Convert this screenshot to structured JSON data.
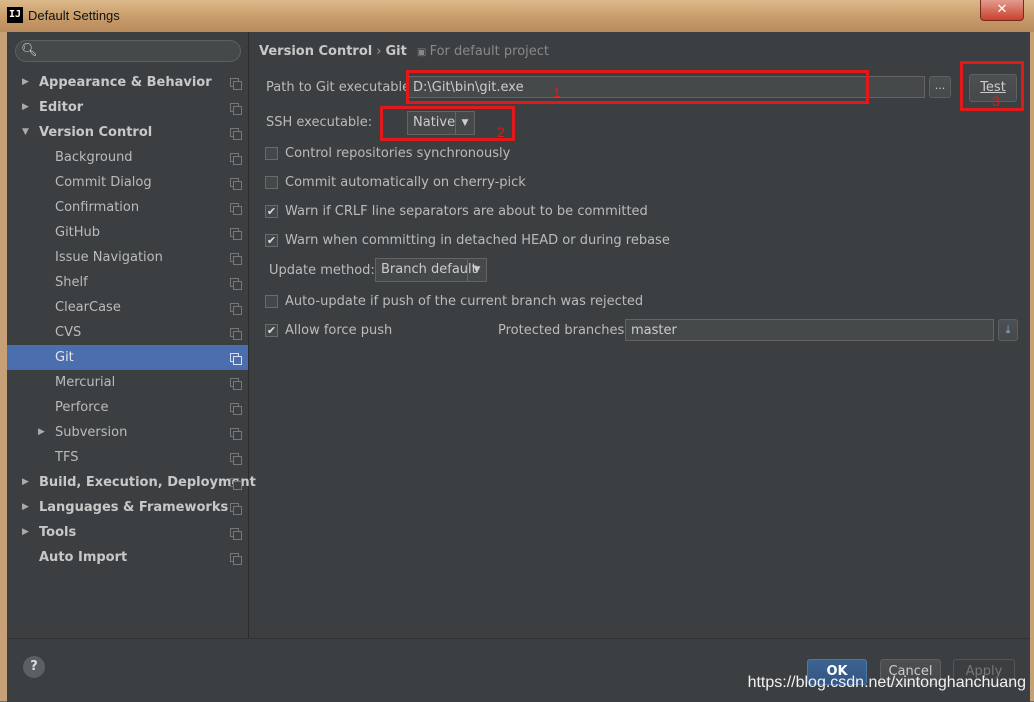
{
  "window": {
    "title": "Default Settings",
    "close_glyph": "✕",
    "app_icon_text": "IJ"
  },
  "sidebar": {
    "search_placeholder": "",
    "items": [
      {
        "label": "Appearance & Behavior",
        "bold": true,
        "arrow": "▶"
      },
      {
        "label": "Editor",
        "bold": true,
        "arrow": "▶"
      },
      {
        "label": "Version Control",
        "bold": true,
        "arrow": "▼"
      },
      {
        "label": "Background"
      },
      {
        "label": "Commit Dialog"
      },
      {
        "label": "Confirmation"
      },
      {
        "label": "GitHub"
      },
      {
        "label": "Issue Navigation"
      },
      {
        "label": "Shelf"
      },
      {
        "label": "ClearCase"
      },
      {
        "label": "CVS"
      },
      {
        "label": "Git",
        "selected": true
      },
      {
        "label": "Mercurial"
      },
      {
        "label": "Perforce"
      },
      {
        "label": "Subversion",
        "arrow": "▶"
      },
      {
        "label": "TFS"
      },
      {
        "label": "Build, Execution, Deployment",
        "bold": true,
        "arrow": "▶"
      },
      {
        "label": "Languages & Frameworks",
        "bold": true,
        "arrow": "▶"
      },
      {
        "label": "Tools",
        "bold": true,
        "arrow": "▶"
      },
      {
        "label": "Auto Import",
        "bold": true
      }
    ]
  },
  "breadcrumb": {
    "section": "Version Control",
    "separator": "›",
    "page": "Git",
    "scope": "For default project"
  },
  "git": {
    "path_label": "Path to Git executable:",
    "path_value": "D:\\Git\\bin\\git.exe",
    "browse_label": "...",
    "test_label": "Test",
    "ssh_label": "SSH executable:",
    "ssh_value": "Native",
    "cb_sync_label": "Control repositories synchronously",
    "cb_cherry_label": "Commit automatically on cherry-pick",
    "cb_crlf_label": "Warn if CRLF line separators are about to be committed",
    "cb_detached_label": "Warn when committing in detached HEAD or during rebase",
    "update_method_label": "Update method:",
    "update_method_value": "Branch default",
    "cb_autoupdate_label": "Auto-update if push of the current branch was rejected",
    "cb_force_label": "Allow force push",
    "protected_label": "Protected branches:",
    "protected_value": "master",
    "checked": {
      "sync": false,
      "cherry": false,
      "crlf": true,
      "detached": true,
      "autoupdate": false,
      "force": true
    }
  },
  "annotations": {
    "n1": "1",
    "n2": "2",
    "n3": "3",
    "color": "#e01a1a"
  },
  "footer": {
    "help": "?",
    "ok": "OK",
    "cancel": "Cancel",
    "apply": "Apply"
  },
  "watermark": "https://blog.csdn.net/xintonghanchuang",
  "colors": {
    "selection": "#4b6eaf",
    "background": "#3c3f41",
    "accent_ok": "#365880"
  }
}
